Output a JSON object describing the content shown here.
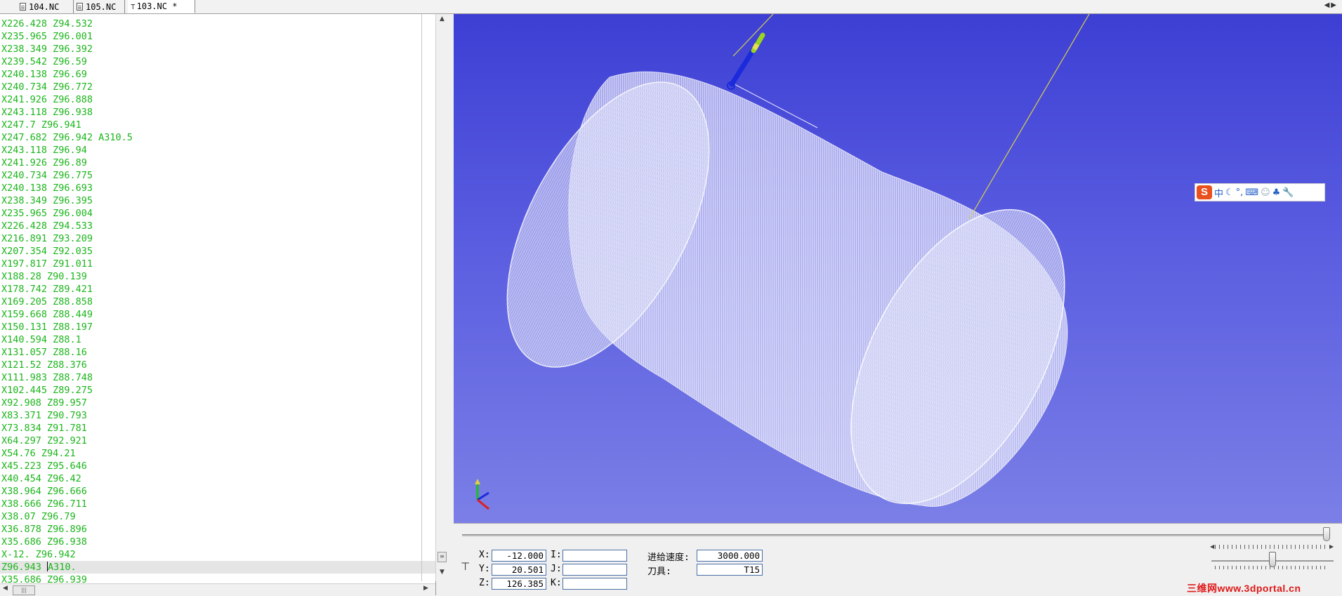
{
  "tabs": [
    {
      "label": "104.NC",
      "active": false
    },
    {
      "label": "105.NC",
      "active": false
    },
    {
      "label": "103.NC *",
      "active": true
    }
  ],
  "code_lines": [
    "X226.428 Z94.532",
    "X235.965 Z96.001",
    "X238.349 Z96.392",
    "X239.542 Z96.59",
    "X240.138 Z96.69",
    "X240.734 Z96.772",
    "X241.926 Z96.888",
    "X243.118 Z96.938",
    "X247.7 Z96.941",
    "X247.682 Z96.942 A310.5",
    "X243.118 Z96.94",
    "X241.926 Z96.89",
    "X240.734 Z96.775",
    "X240.138 Z96.693",
    "X238.349 Z96.395",
    "X235.965 Z96.004",
    "X226.428 Z94.533",
    "X216.891 Z93.209",
    "X207.354 Z92.035",
    "X197.817 Z91.011",
    "X188.28 Z90.139",
    "X178.742 Z89.421",
    "X169.205 Z88.858",
    "X159.668 Z88.449",
    "X150.131 Z88.197",
    "X140.594 Z88.1",
    "X131.057 Z88.16",
    "X121.52 Z88.376",
    "X111.983 Z88.748",
    "X102.445 Z89.275",
    "X92.908 Z89.957",
    "X83.371 Z90.793",
    "X73.834 Z91.781",
    "X64.297 Z92.921",
    "X54.76 Z94.21",
    "X45.223 Z95.646",
    "X40.454 Z96.42",
    "X38.964 Z96.666",
    "X38.666 Z96.711",
    "X38.07 Z96.79",
    "X36.878 Z96.896",
    "X35.686 Z96.938",
    "X-12. Z96.942",
    "Z96.943 A310.",
    "X35.686 Z96.939"
  ],
  "current_line_index": 43,
  "ime_toolbar": {
    "logo": "S",
    "mode": "中"
  },
  "coords": {
    "x_label": "X:",
    "x_value": "-12.000",
    "y_label": "Y:",
    "y_value": "20.501",
    "z_label": "Z:",
    "z_value": "126.385",
    "i_label": "I:",
    "i_value": "",
    "j_label": "J:",
    "j_value": "",
    "k_label": "K:",
    "k_value": ""
  },
  "feed_rate_label": "进给速度:",
  "feed_rate_value": "3000.000",
  "tool_label": "刀具:",
  "tool_value": "T15",
  "playback_progress": 1.0,
  "speed_slider_level": 0.5,
  "watermark": "三维网www.3dportal.cn",
  "colors": {
    "code_text": "#1bb51b",
    "viewport_top": "#3d3fd4",
    "viewport_bottom": "#7b7fe6"
  }
}
